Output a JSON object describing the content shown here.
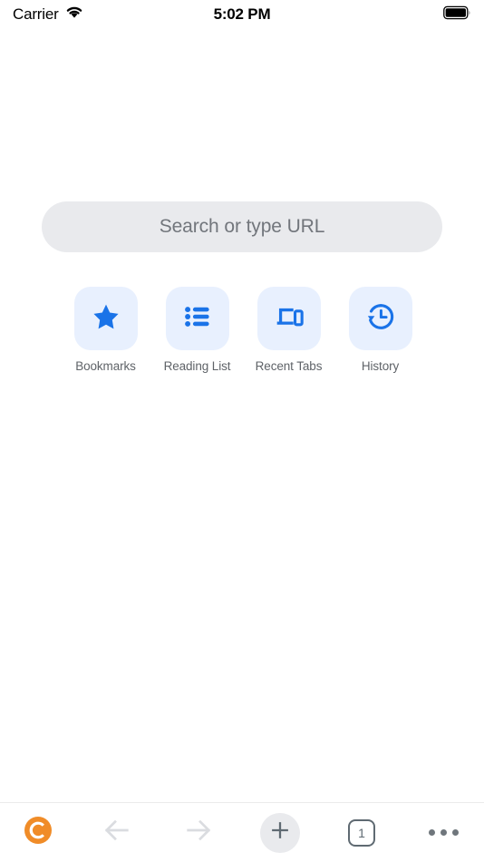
{
  "status_bar": {
    "carrier": "Carrier",
    "wifi_icon": "wifi-icon",
    "time": "5:02 PM",
    "battery_icon": "battery-full-icon"
  },
  "search": {
    "placeholder": "Search or type URL",
    "background_color": "#e9eaed",
    "text_color": "#72767c"
  },
  "shortcuts": {
    "tile_background": "#e8f0fe",
    "icon_color": "#1a73e8",
    "label_color": "#5f6368",
    "items": [
      {
        "label": "Bookmarks",
        "icon": "star-icon"
      },
      {
        "label": "Reading List",
        "icon": "list-icon"
      },
      {
        "label": "Recent Tabs",
        "icon": "devices-icon"
      },
      {
        "label": "History",
        "icon": "clock-history-icon"
      }
    ]
  },
  "toolbar": {
    "brand_icon": "chromium-c-logo-icon",
    "brand_color": "#f08c28",
    "back_icon": "arrow-back-icon",
    "forward_icon": "arrow-forward-icon",
    "new_tab_icon": "plus-icon",
    "tab_count": "1",
    "menu_icon": "more-horizontal-icon",
    "disabled_color": "#dadce0",
    "enabled_color": "#5f6a72"
  }
}
